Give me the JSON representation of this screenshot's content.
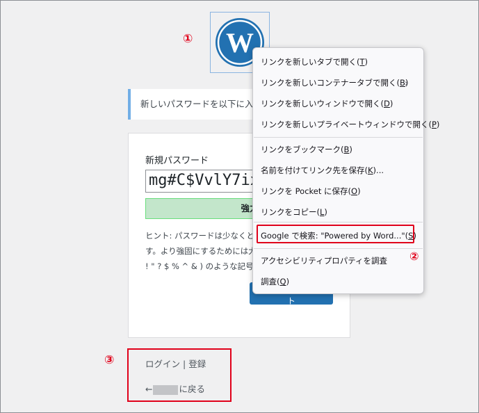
{
  "markers": {
    "m1": "①",
    "m2": "②",
    "m3": "③"
  },
  "notice": {
    "text": "新しいパスワードを以下に入力し"
  },
  "form": {
    "label": "新規パスワード",
    "password_value": "mg#C$VvlY7ix",
    "strength": "強力",
    "hint_lines": [
      "ヒント: パスワードは少なくとも7",
      "す。より強固にするためには大",
      "! \" ? $ % ^ & ) のような記号"
    ],
    "reset_button": "パスワードをリセット"
  },
  "links": {
    "login": "ログイン",
    "separator": "|",
    "register": "登録",
    "back_arrow": "←",
    "back_suffix": "に戻る"
  },
  "context_menu": {
    "items": [
      {
        "text": "リンクを新しいタブで開く(",
        "key": "T",
        "close": ")"
      },
      {
        "text": "リンクを新しいコンテナータブで開く(",
        "key": "B",
        "close": ")"
      },
      {
        "text": "リンクを新しいウィンドウで開く(",
        "key": "D",
        "close": ")"
      },
      {
        "text": "リンクを新しいプライベートウィンドウで開く(",
        "key": "P",
        "close": ")"
      },
      {
        "text": "リンクをブックマーク(",
        "key": "B",
        "close": ")"
      },
      {
        "text": "名前を付けてリンク先を保存(",
        "key": "K",
        "close": ")..."
      },
      {
        "text": "リンクを Pocket に保存(",
        "key": "O",
        "close": ")"
      },
      {
        "text": "リンクをコピー(",
        "key": "L",
        "close": ")"
      },
      {
        "text": "Google で検索: \"Powered by Word...\"(",
        "key": "S",
        "close": ")"
      },
      {
        "text": "アクセシビリティプロパティを調査",
        "key": "",
        "close": ""
      },
      {
        "text": "調査(",
        "key": "Q",
        "close": ")"
      }
    ],
    "submenu_chevron": "›"
  },
  "colors": {
    "accent": "#2271b1",
    "highlight": "#e0001a",
    "strength_bg": "#c3e6cb",
    "notice_border": "#72aee6"
  }
}
